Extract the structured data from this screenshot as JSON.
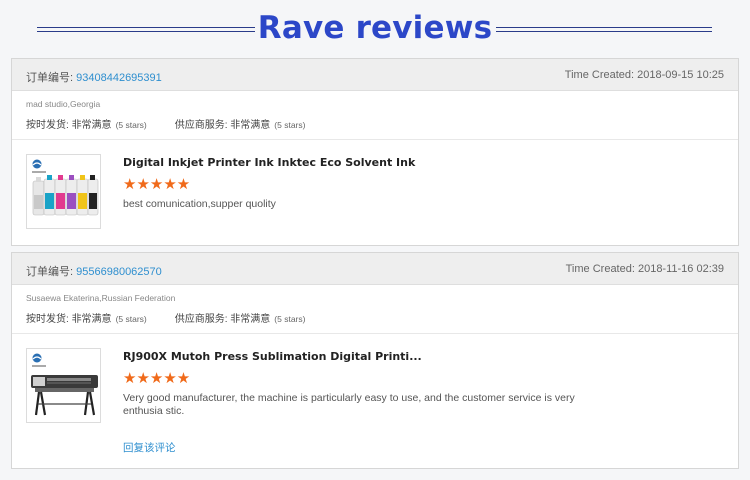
{
  "header": {
    "title": "Rave reviews"
  },
  "reviews": [
    {
      "order_label": "订单编号:",
      "order_number": "93408442695391",
      "time_created": "Time Created: 2018-09-15 10:25",
      "buyer": "mad studio,Georgia",
      "delivery_label": "按时发货:",
      "delivery_value": "非常满意",
      "delivery_stars": "(5 stars)",
      "service_label": "供应商服务:",
      "service_value": "非常满意",
      "service_stars": "(5 stars)",
      "product_title": "Digital Inkjet Printer Ink Inktec Eco Solvent Ink",
      "rating": 5,
      "stars_display": "★★★★★",
      "comment": "best comunication,supper quolity",
      "thumbnail_icon": "ink-bottles-image"
    },
    {
      "order_label": "订单编号:",
      "order_number": "95566980062570",
      "time_created": "Time Created: 2018-11-16 02:39",
      "buyer": "Susaewa Ekaterina,Russian Federation",
      "delivery_label": "按时发货:",
      "delivery_value": "非常满意",
      "delivery_stars": "(5 stars)",
      "service_label": "供应商服务:",
      "service_value": "非常满意",
      "service_stars": "(5 stars)",
      "product_title": "RJ900X Mutoh Press Sublimation Digital Printi...",
      "rating": 5,
      "stars_display": "★★★★★",
      "comment": "Very good manufacturer, the machine is particularly easy to use, and the customer service is very enthusia stic.",
      "reply_link": "回复该评论",
      "thumbnail_icon": "printer-image"
    }
  ],
  "colors": {
    "title": "#2c47c8",
    "link": "#2f8fcf",
    "star": "#f06a1a"
  }
}
